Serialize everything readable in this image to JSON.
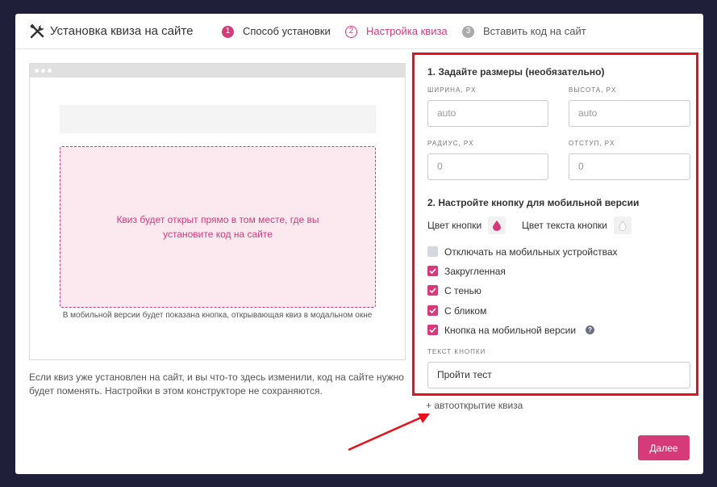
{
  "header": {
    "title": "Установка квиза на сайте",
    "steps": [
      {
        "num": "1",
        "label": "Способ установки"
      },
      {
        "num": "2",
        "label": "Настройка квиза"
      },
      {
        "num": "3",
        "label": "Вставить код на сайт"
      }
    ]
  },
  "preview": {
    "quiz_zone_text": "Квиз будет открыт прямо в том месте, где вы установите код на сайте",
    "mobile_note": "В мобильной версии будет показана кнопка, открывающая квиз в модальном окне"
  },
  "footer_note": "Если квиз уже установлен на сайт, и вы что-то здесь изменили, код на сайте нужно будет поменять. Настройки в этом конструкторе не сохраняются.",
  "settings": {
    "size_title": "1. Задайте размеры (необязательно)",
    "width_label": "ШИРИНА, PX",
    "width_value": "auto",
    "height_label": "ВЫСОТА, PX",
    "height_value": "auto",
    "radius_label": "РАДИУС, PX",
    "radius_value": "0",
    "offset_label": "ОТСТУП, PX",
    "offset_value": "0",
    "mobile_title": "2. Настройте кнопку для мобильной версии",
    "button_color_label": "Цвет кнопки",
    "text_color_label": "Цвет текста кнопки",
    "checkboxes": [
      {
        "label": "Отключать на мобильных устройствах",
        "checked": false
      },
      {
        "label": "Закругленная",
        "checked": true
      },
      {
        "label": "С тенью",
        "checked": true
      },
      {
        "label": "С бликом",
        "checked": true
      },
      {
        "label": "Кнопка на мобильной версии",
        "checked": true
      }
    ],
    "help_glyph": "?",
    "button_text_label": "ТЕКСТ КНОПКИ",
    "button_text_value": "Пройти тест"
  },
  "autoopen_link": "+ автооткрытие квиза",
  "next_button": "Далее",
  "colors": {
    "accent": "#d63a79",
    "highlight_border": "#e8101a",
    "background": "#1f1f3a"
  }
}
